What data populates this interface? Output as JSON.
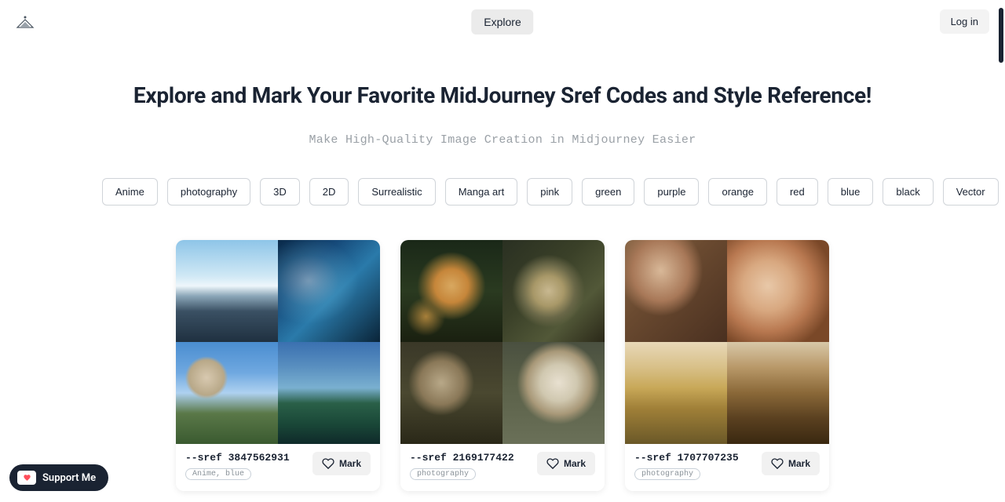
{
  "header": {
    "explore_label": "Explore",
    "login_label": "Log in"
  },
  "hero": {
    "title": "Explore and Mark Your Favorite MidJourney Sref Codes and Style Reference!",
    "subtitle": "Make High-Quality Image Creation in Midjourney Easier"
  },
  "tags": [
    "Anime",
    "photography",
    "3D",
    "2D",
    "Surrealistic",
    "Manga art",
    "pink",
    "green",
    "purple",
    "orange",
    "red",
    "blue",
    "black",
    "Vector"
  ],
  "cards": [
    {
      "code": "--sref 3847562931",
      "tags": "Anime, blue",
      "mark_label": "Mark"
    },
    {
      "code": "--sref 2169177422",
      "tags": "photography",
      "mark_label": "Mark"
    },
    {
      "code": "--sref 1707707235",
      "tags": "photography",
      "mark_label": "Mark"
    }
  ],
  "support": {
    "label": "Support Me"
  }
}
